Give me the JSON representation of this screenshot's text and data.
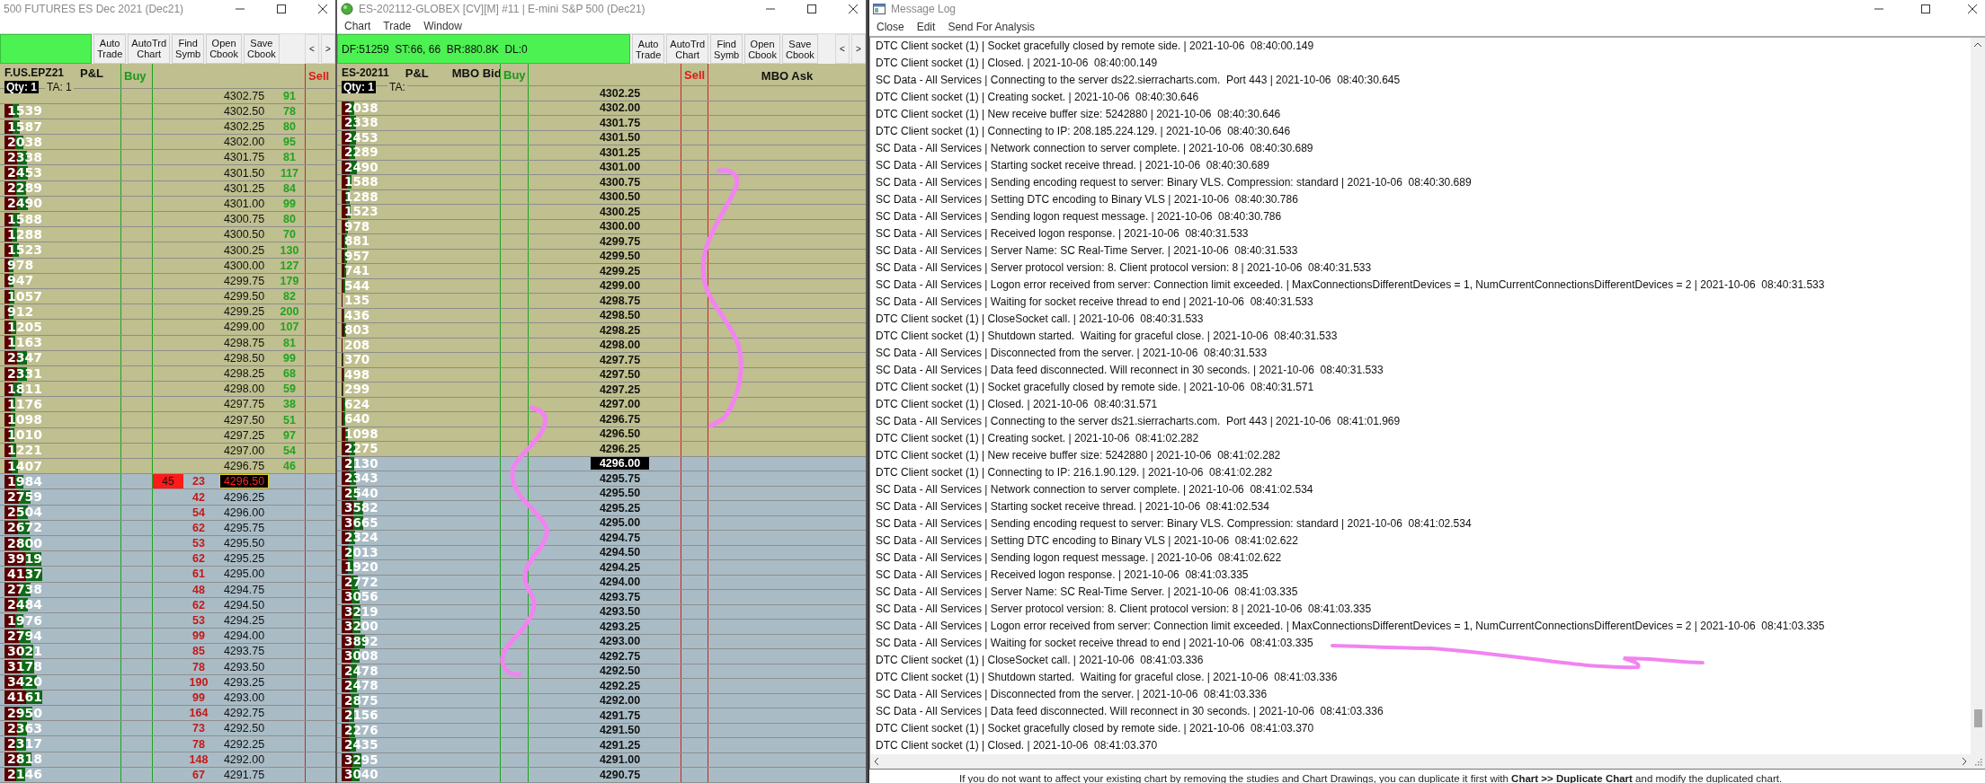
{
  "dom_windows": [
    {
      "kind": "basic",
      "title": "500 FUTURES ES Dec 2021 (Dec21)",
      "toolbar": [
        "Auto Trade",
        "AutoTrd Chart",
        "Find Symb",
        "Open Cbook",
        "Save Cbook"
      ],
      "nav": [
        "<",
        ">"
      ],
      "columns": [
        {
          "label": "F.US.EPZ21",
          "kind": "symbol"
        },
        {
          "label": "P&L",
          "kind": "pnl"
        },
        {
          "label": "Buy",
          "kind": "buy"
        },
        {
          "label": "Sell",
          "kind": "sell"
        }
      ],
      "qty_label": "Qty: 1",
      "ta_label": "TA: 1",
      "ask_rows": [
        {
          "price": "4302.75",
          "ask": "91",
          "current": false
        },
        {
          "vol": "1539",
          "price": "4302.50",
          "ask": "78",
          "current": false
        },
        {
          "vol": "1587",
          "price": "4302.25",
          "ask": "80",
          "current": false
        },
        {
          "vol": "2038",
          "price": "4302.00",
          "ask": "95",
          "current": false
        },
        {
          "vol": "2338",
          "price": "4301.75",
          "ask": "81",
          "current": false
        },
        {
          "vol": "2453",
          "price": "4301.50",
          "ask": "117",
          "current": false
        },
        {
          "vol": "2289",
          "price": "4301.25",
          "ask": "84",
          "current": false
        },
        {
          "vol": "2490",
          "price": "4301.00",
          "ask": "99",
          "current": false
        },
        {
          "vol": "1588",
          "price": "4300.75",
          "ask": "80",
          "current": false
        },
        {
          "vol": "1288",
          "price": "4300.50",
          "ask": "70",
          "current": false
        },
        {
          "vol": "1523",
          "price": "4300.25",
          "ask": "130",
          "current": false
        },
        {
          "vol": "978",
          "price": "4300.00",
          "ask": "127",
          "current": false
        },
        {
          "vol": "947",
          "price": "4299.75",
          "ask": "179",
          "current": false
        },
        {
          "vol": "1057",
          "price": "4299.50",
          "ask": "82",
          "current": false
        },
        {
          "vol": "912",
          "price": "4299.25",
          "ask": "200",
          "current": false
        },
        {
          "vol": "1205",
          "price": "4299.00",
          "ask": "107",
          "current": false
        },
        {
          "vol": "1163",
          "price": "4298.75",
          "ask": "81",
          "current": false
        },
        {
          "vol": "2347",
          "price": "4298.50",
          "ask": "99",
          "current": false
        },
        {
          "vol": "2331",
          "price": "4298.25",
          "ask": "68",
          "current": false
        },
        {
          "vol": "1811",
          "price": "4298.00",
          "ask": "59",
          "current": false
        },
        {
          "vol": "1176",
          "price": "4297.75",
          "ask": "38",
          "current": false
        },
        {
          "vol": "1098",
          "price": "4297.50",
          "ask": "51",
          "current": false
        },
        {
          "vol": "1010",
          "price": "4297.25",
          "ask": "97",
          "current": false
        },
        {
          "vol": "1221",
          "price": "4297.00",
          "ask": "54",
          "current": false
        },
        {
          "vol": "1407",
          "price": "4296.75",
          "ask": "46",
          "current": false
        }
      ],
      "bid_rows": [
        {
          "vol": "1984",
          "trade": "45",
          "bid": "23",
          "price": "4296.50",
          "current": true
        },
        {
          "vol": "2759",
          "bid": "42",
          "price": "4296.25",
          "current": false
        },
        {
          "vol": "2504",
          "bid": "54",
          "price": "4296.00",
          "current": false
        },
        {
          "vol": "2672",
          "bid": "62",
          "price": "4295.75",
          "current": false
        },
        {
          "vol": "2800",
          "bid": "53",
          "price": "4295.50",
          "current": false
        },
        {
          "vol": "3919",
          "bid": "62",
          "price": "4295.25",
          "current": false
        },
        {
          "vol": "4137",
          "bid": "61",
          "price": "4295.00",
          "current": false
        },
        {
          "vol": "2738",
          "bid": "48",
          "price": "4294.75",
          "current": false
        },
        {
          "vol": "2484",
          "bid": "62",
          "price": "4294.50",
          "current": false
        },
        {
          "vol": "1976",
          "bid": "53",
          "price": "4294.25",
          "current": false
        },
        {
          "vol": "2794",
          "bid": "99",
          "price": "4294.00",
          "current": false
        },
        {
          "vol": "3021",
          "bid": "85",
          "price": "4293.75",
          "current": false
        },
        {
          "vol": "3178",
          "bid": "78",
          "price": "4293.50",
          "current": false
        },
        {
          "vol": "3420",
          "bid": "190",
          "price": "4293.25",
          "current": false
        },
        {
          "vol": "4161",
          "bid": "99",
          "price": "4293.00",
          "current": false
        },
        {
          "vol": "2950",
          "bid": "164",
          "price": "4292.75",
          "current": false
        },
        {
          "vol": "2363",
          "bid": "73",
          "price": "4292.50",
          "current": false
        },
        {
          "vol": "2317",
          "bid": "78",
          "price": "4292.25",
          "current": false
        },
        {
          "vol": "2818",
          "bid": "148",
          "price": "4292.00",
          "current": false
        },
        {
          "vol": "2146",
          "bid": "67",
          "price": "4291.75",
          "current": false
        }
      ]
    },
    {
      "kind": "mbo",
      "title": "ES-202112-GLOBEX [CV][M]  #11 | E-mini S&P 500 (Dec21)",
      "menu": [
        "Chart",
        "Trade",
        "Window"
      ],
      "status": "DF:51259  ST:66, 66  BR:880.8K  DL:0",
      "toolbar": [
        "Auto Trade",
        "AutoTrd Chart",
        "Find Symb",
        "Open Cbook",
        "Save Cbook"
      ],
      "nav": [
        "<",
        ">"
      ],
      "columns": [
        {
          "label": "ES-20211",
          "kind": "symbol"
        },
        {
          "label": "P&L",
          "kind": "pnl"
        },
        {
          "label": "MBO Bid",
          "kind": "mbo_bid"
        },
        {
          "label": "Buy",
          "kind": "buy"
        },
        {
          "label": "Sell",
          "kind": "sell"
        },
        {
          "label": "MBO Ask",
          "kind": "mbo_ask"
        }
      ],
      "qty_label": "Qty: 1",
      "ta_label": "TA:",
      "ask_rows": [
        {
          "price": "4302.25",
          "current": false
        },
        {
          "vol": "2038",
          "price": "4302.00",
          "current": false
        },
        {
          "vol": "2338",
          "price": "4301.75",
          "current": false
        },
        {
          "vol": "2453",
          "price": "4301.50",
          "current": false
        },
        {
          "vol": "2289",
          "price": "4301.25",
          "current": false
        },
        {
          "vol": "2490",
          "price": "4301.00",
          "current": false
        },
        {
          "vol": "1588",
          "price": "4300.75",
          "current": false
        },
        {
          "vol": "1288",
          "price": "4300.50",
          "current": false
        },
        {
          "vol": "1523",
          "price": "4300.25",
          "current": false
        },
        {
          "vol": "978",
          "price": "4300.00",
          "current": false
        },
        {
          "vol": "881",
          "price": "4299.75",
          "current": false
        },
        {
          "vol": "957",
          "price": "4299.50",
          "current": false
        },
        {
          "vol": "741",
          "price": "4299.25",
          "current": false
        },
        {
          "vol": "544",
          "price": "4299.00",
          "current": false
        },
        {
          "vol": "135",
          "price": "4298.75",
          "current": false
        },
        {
          "vol": "436",
          "price": "4298.50",
          "current": false
        },
        {
          "vol": "803",
          "price": "4298.25",
          "current": false
        },
        {
          "vol": "208",
          "price": "4298.00",
          "current": false
        },
        {
          "vol": "370",
          "price": "4297.75",
          "current": false
        },
        {
          "vol": "498",
          "price": "4297.50",
          "current": false
        },
        {
          "vol": "299",
          "price": "4297.25",
          "current": false
        },
        {
          "vol": "624",
          "price": "4297.00",
          "current": false
        },
        {
          "vol": "640",
          "price": "4296.75",
          "current": false
        },
        {
          "vol": "1098",
          "price": "4296.50",
          "current": false
        },
        {
          "vol": "2275",
          "price": "4296.25",
          "current": false
        }
      ],
      "bid_rows": [
        {
          "vol": "2130",
          "price": "4296.00",
          "current": true
        },
        {
          "vol": "2343",
          "price": "4295.75",
          "current": false
        },
        {
          "vol": "2540",
          "price": "4295.50",
          "current": false
        },
        {
          "vol": "3582",
          "price": "4295.25",
          "current": false
        },
        {
          "vol": "3665",
          "price": "4295.00",
          "current": false
        },
        {
          "vol": "2324",
          "price": "4294.75",
          "current": false
        },
        {
          "vol": "2013",
          "price": "4294.50",
          "current": false
        },
        {
          "vol": "1920",
          "price": "4294.25",
          "current": false
        },
        {
          "vol": "2772",
          "price": "4294.00",
          "current": false
        },
        {
          "vol": "3056",
          "price": "4293.75",
          "current": false
        },
        {
          "vol": "3219",
          "price": "4293.50",
          "current": false
        },
        {
          "vol": "3200",
          "price": "4293.25",
          "current": false
        },
        {
          "vol": "3892",
          "price": "4293.00",
          "current": false
        },
        {
          "vol": "3008",
          "price": "4292.75",
          "current": false
        },
        {
          "vol": "2478",
          "price": "4292.50",
          "current": false
        },
        {
          "vol": "2478",
          "price": "4292.25",
          "current": false
        },
        {
          "vol": "2875",
          "price": "4292.00",
          "current": false
        },
        {
          "vol": "2156",
          "price": "4291.75",
          "current": false
        },
        {
          "vol": "2276",
          "price": "4291.50",
          "current": false
        },
        {
          "vol": "2435",
          "price": "4291.25",
          "current": false
        },
        {
          "vol": "3295",
          "price": "4291.00",
          "current": false
        },
        {
          "vol": "3040",
          "price": "4290.75",
          "current": false
        }
      ]
    }
  ],
  "message_log": {
    "title": "Message Log",
    "menu": [
      "Close",
      "Edit",
      "Send For Analysis"
    ],
    "lines": [
      "DTC Client socket (1) | Socket gracefully closed by remote side. | 2021-10-06  08:40:00.149",
      "DTC Client socket (1) | Closed. | 2021-10-06  08:40:00.149",
      "SC Data - All Services | Connecting to the server ds22.sierracharts.com.  Port 443 | 2021-10-06  08:40:30.645",
      "DTC Client socket (1) | Creating socket. | 2021-10-06  08:40:30.646",
      "DTC Client socket (1) | New receive buffer size: 5242880 | 2021-10-06  08:40:30.646",
      "DTC Client socket (1) | Connecting to IP: 208.185.224.129. | 2021-10-06  08:40:30.646",
      "SC Data - All Services | Network connection to server complete. | 2021-10-06  08:40:30.689",
      "SC Data - All Services | Starting socket receive thread. | 2021-10-06  08:40:30.689",
      "SC Data - All Services | Sending encoding request to server: Binary VLS. Compression: standard | 2021-10-06  08:40:30.689",
      "SC Data - All Services | Setting DTC encoding to Binary VLS | 2021-10-06  08:40:30.786",
      "SC Data - All Services | Sending logon request message. | 2021-10-06  08:40:30.786",
      "SC Data - All Services | Received logon response. | 2021-10-06  08:40:31.533",
      "SC Data - All Services | Server Name: SC Real-Time Server. | 2021-10-06  08:40:31.533",
      "SC Data - All Services | Server protocol version: 8. Client protocol version: 8 | 2021-10-06  08:40:31.533",
      "SC Data - All Services | Logon error received from server: Connection limit exceeded. | MaxConnectionsDifferentDevices = 1, NumCurrentConnectionsDifferentDevices = 2 | 2021-10-06  08:40:31.533",
      "SC Data - All Services | Waiting for socket receive thread to end | 2021-10-06  08:40:31.533",
      "DTC Client socket (1) | CloseSocket call. | 2021-10-06  08:40:31.533",
      "DTC Client socket (1) | Shutdown started.  Waiting for graceful close. | 2021-10-06  08:40:31.533",
      "SC Data - All Services | Disconnected from the server. | 2021-10-06  08:40:31.533",
      "SC Data - All Services | Data feed disconnected. Will reconnect in 30 seconds. | 2021-10-06  08:40:31.533",
      "DTC Client socket (1) | Socket gracefully closed by remote side. | 2021-10-06  08:40:31.571",
      "DTC Client socket (1) | Closed. | 2021-10-06  08:40:31.571",
      "SC Data - All Services | Connecting to the server ds21.sierracharts.com.  Port 443 | 2021-10-06  08:41:01.969",
      "DTC Client socket (1) | Creating socket. | 2021-10-06  08:41:02.282",
      "DTC Client socket (1) | New receive buffer size: 5242880 | 2021-10-06  08:41:02.282",
      "DTC Client socket (1) | Connecting to IP: 216.1.90.129. | 2021-10-06  08:41:02.282",
      "SC Data - All Services | Network connection to server complete. | 2021-10-06  08:41:02.534",
      "SC Data - All Services | Starting socket receive thread. | 2021-10-06  08:41:02.534",
      "SC Data - All Services | Sending encoding request to server: Binary VLS. Compression: standard | 2021-10-06  08:41:02.534",
      "SC Data - All Services | Setting DTC encoding to Binary VLS | 2021-10-06  08:41:02.622",
      "SC Data - All Services | Sending logon request message. | 2021-10-06  08:41:02.622",
      "SC Data - All Services | Received logon response. | 2021-10-06  08:41:03.335",
      "SC Data - All Services | Server Name: SC Real-Time Server. | 2021-10-06  08:41:03.335",
      "SC Data - All Services | Server protocol version: 8. Client protocol version: 8 | 2021-10-06  08:41:03.335",
      "SC Data - All Services | Logon error received from server: Connection limit exceeded. | MaxConnectionsDifferentDevices = 1, NumCurrentConnectionsDifferentDevices = 2 | 2021-10-06  08:41:03.335",
      "SC Data - All Services | Waiting for socket receive thread to end | 2021-10-06  08:41:03.335",
      "DTC Client socket (1) | CloseSocket call. | 2021-10-06  08:41:03.336",
      "DTC Client socket (1) | Shutdown started.  Waiting for graceful close. | 2021-10-06  08:41:03.336",
      "SC Data - All Services | Disconnected from the server. | 2021-10-06  08:41:03.336",
      "SC Data - All Services | Data feed disconnected. Will reconnect in 30 seconds. | 2021-10-06  08:41:03.336",
      "DTC Client socket (1) | Socket gracefully closed by remote side. | 2021-10-06  08:41:03.370",
      "DTC Client socket (1) | Closed. | 2021-10-06  08:41:03.370"
    ]
  },
  "background_text": "If you do not want to affect your existing chart by removing the studies and Chart Drawings, you can duplicate it first with **Chart >> Duplicate Chart** and modify the duplicated chart."
}
